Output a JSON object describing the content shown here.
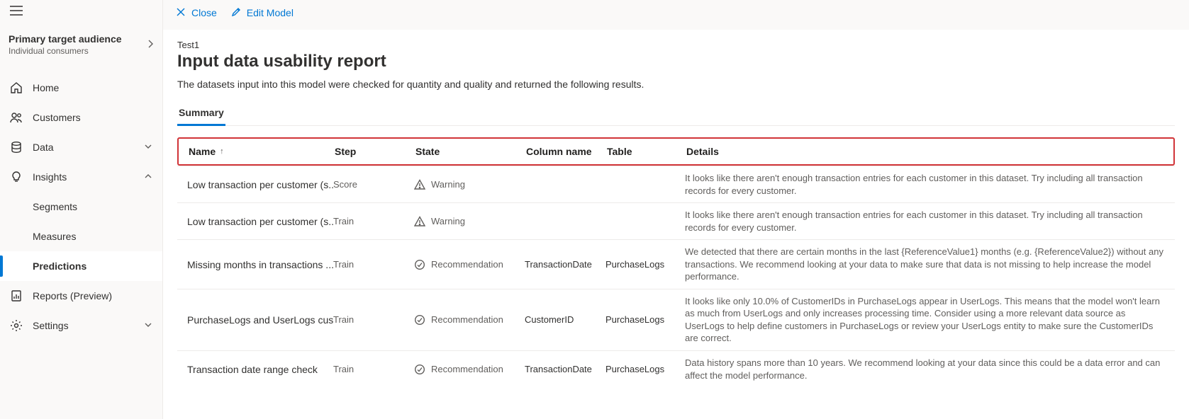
{
  "sidebar": {
    "context": {
      "title": "Primary target audience",
      "subtitle": "Individual consumers"
    },
    "items": [
      {
        "id": "home",
        "label": "Home"
      },
      {
        "id": "customers",
        "label": "Customers"
      },
      {
        "id": "data",
        "label": "Data"
      },
      {
        "id": "insights",
        "label": "Insights"
      },
      {
        "id": "reports",
        "label": "Reports (Preview)"
      },
      {
        "id": "settings",
        "label": "Settings"
      }
    ],
    "insights_children": [
      {
        "id": "segments",
        "label": "Segments"
      },
      {
        "id": "measures",
        "label": "Measures"
      },
      {
        "id": "predictions",
        "label": "Predictions"
      }
    ]
  },
  "commands": {
    "close": "Close",
    "edit": "Edit Model"
  },
  "page": {
    "breadcrumb": "Test1",
    "title": "Input data usability report",
    "description": "The datasets input into this model were checked for quantity and quality and returned the following results.",
    "tab_summary": "Summary"
  },
  "table": {
    "headers": {
      "name": "Name",
      "step": "Step",
      "state": "State",
      "column_name": "Column name",
      "table": "Table",
      "details": "Details"
    },
    "rows": [
      {
        "name": "Low transaction per customer (s...",
        "step": "Score",
        "state_kind": "warning",
        "state": "Warning",
        "column_name": "",
        "table": "",
        "details": "It looks like there aren't enough transaction entries for each customer in this dataset. Try including all transaction records for every customer."
      },
      {
        "name": "Low transaction per customer (s...",
        "step": "Train",
        "state_kind": "warning",
        "state": "Warning",
        "column_name": "",
        "table": "",
        "details": "It looks like there aren't enough transaction entries for each customer in this dataset. Try including all transaction records for every customer."
      },
      {
        "name": "Missing months in transactions ...",
        "step": "Train",
        "state_kind": "recommendation",
        "state": "Recommendation",
        "column_name": "TransactionDate",
        "table": "PurchaseLogs",
        "details": "We detected that there are certain months in the last {ReferenceValue1} months (e.g. {ReferenceValue2}) without any transactions. We recommend looking at your data to make sure that data is not missing to help increase the model performance."
      },
      {
        "name": "PurchaseLogs and UserLogs cus...",
        "step": "Train",
        "state_kind": "recommendation",
        "state": "Recommendation",
        "column_name": "CustomerID",
        "table": "PurchaseLogs",
        "details": "It looks like only 10.0% of CustomerIDs in PurchaseLogs appear in UserLogs. This means that the model won't learn as much from UserLogs and only increases processing time. Consider using a more relevant data source as UserLogs to help define customers in PurchaseLogs or review your UserLogs entity to make sure the CustomerIDs are correct."
      },
      {
        "name": "Transaction date range check",
        "step": "Train",
        "state_kind": "recommendation",
        "state": "Recommendation",
        "column_name": "TransactionDate",
        "table": "PurchaseLogs",
        "details": "Data history spans more than 10 years. We recommend looking at your data since this could be a data error and can affect the model performance."
      }
    ]
  }
}
